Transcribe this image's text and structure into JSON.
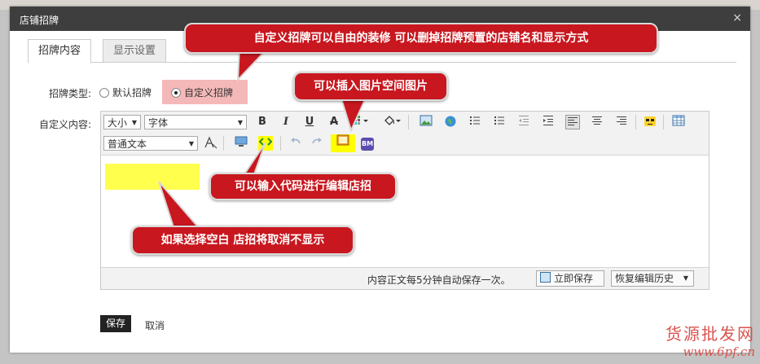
{
  "dialog": {
    "title": "店铺招牌",
    "close_glyph": "×"
  },
  "tabs": [
    {
      "label": "招牌内容",
      "active": true
    },
    {
      "label": "显示设置",
      "active": false
    }
  ],
  "form": {
    "type_label": "招牌类型:",
    "type_options": [
      {
        "label": "默认招牌",
        "selected": false
      },
      {
        "label": "自定义招牌",
        "selected": true
      }
    ],
    "content_label": "自定义内容:"
  },
  "toolbar": {
    "size_select": "大小",
    "font_select": "字体",
    "format_select": "普通文本",
    "bold": "B",
    "italic": "I",
    "underline": "U",
    "strike": "A",
    "icons": [
      "bold-icon",
      "italic-icon",
      "underline-icon",
      "strikethrough-icon",
      "color-grid-icon",
      "fill-icon",
      "image-icon",
      "globe-icon",
      "bullet-list-icon",
      "numbered-list-icon",
      "outdent-icon",
      "indent-icon",
      "align-left-icon",
      "align-center-icon",
      "align-right-icon",
      "emoticon-icon",
      "table-icon",
      "clear-format-icon",
      "media-icon",
      "code-icon",
      "undo-icon",
      "redo-icon",
      "insert-image-space-icon",
      "bm-icon"
    ],
    "bm_label": "BM"
  },
  "statusbar": {
    "autosave_text": "内容正文每5分钟自动保存一次。",
    "save_now": "立即保存",
    "restore_history": "恢复编辑历史"
  },
  "actions": {
    "save": "保存",
    "cancel": "取消"
  },
  "callouts": {
    "top": "自定义招牌可以自由的装修 可以删掉招牌预置的店铺名和显示方式",
    "image": "可以插入图片空间图片",
    "code": "可以输入代码进行编辑店招",
    "blank": "如果选择空白 店招将取消不显示"
  },
  "watermark": {
    "line1": "货源批发网",
    "line2": "www.6pf.cn"
  },
  "colors": {
    "callout": "#c8171f",
    "highlight_yellow": "#ffff00",
    "radio_highlight": "#f5b8b8",
    "titlebar": "#3e3e3e"
  }
}
